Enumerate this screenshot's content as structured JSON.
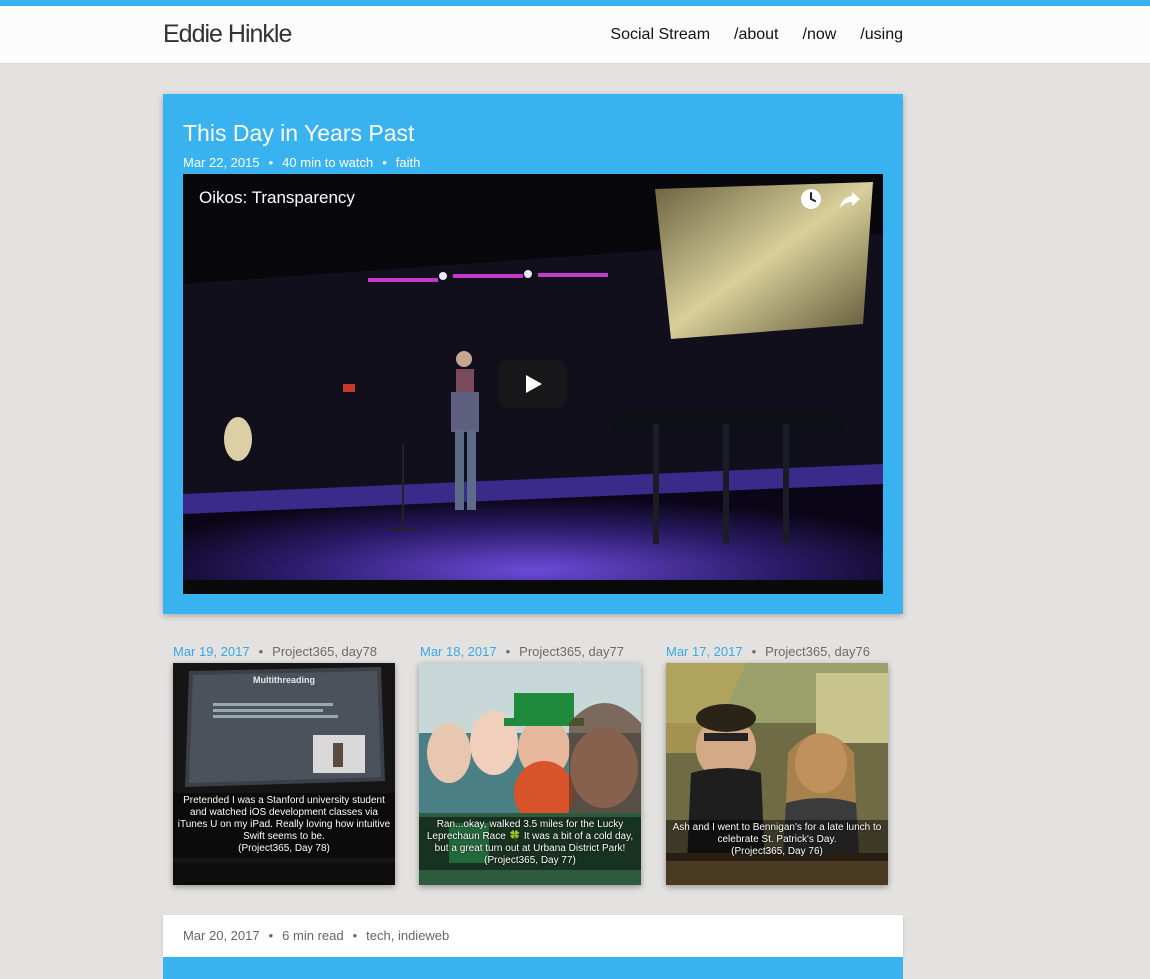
{
  "header": {
    "site_title": "Eddie Hinkle",
    "nav": [
      "Social Stream",
      "/about",
      "/now",
      "/using"
    ]
  },
  "feature": {
    "title": "This Day in Years Past",
    "date": "Mar 22, 2015",
    "duration": "40 min to watch",
    "tag": "faith",
    "video": {
      "title": "Oikos: Transparency",
      "icons": [
        "clock-icon",
        "share-icon",
        "play-icon"
      ]
    }
  },
  "cards": [
    {
      "date": "Mar 19, 2017",
      "tag": "Project365, day78",
      "caption": [
        "Pretended I was a Stanford university student",
        "and watched iOS development classes via",
        "iTunes U on my iPad. Really loving how intuitive",
        "Swift seems to be.",
        "(Project365, Day 78)"
      ],
      "slide_title": "Multithreading"
    },
    {
      "date": "Mar 18, 2017",
      "tag": "Project365, day77",
      "caption": [
        "Ran...okay, walked 3.5 miles for the Lucky",
        "Leprechaun Race 🍀 It was a bit of a cold day,",
        "but a great turn out at Urbana District Park!",
        "(Project365, Day 77)"
      ]
    },
    {
      "date": "Mar 17, 2017",
      "tag": "Project365, day76",
      "caption": [
        "Ash and I went to Bennigan's for a late lunch to",
        "celebrate St. Patrick's Day.",
        "(Project365, Day 76)"
      ]
    }
  ],
  "post": {
    "date": "Mar 20, 2017",
    "read_time": "6 min read",
    "tags": "tech, indieweb"
  },
  "colors": {
    "accent": "#38b3ef",
    "background": "#e3e2e0"
  }
}
